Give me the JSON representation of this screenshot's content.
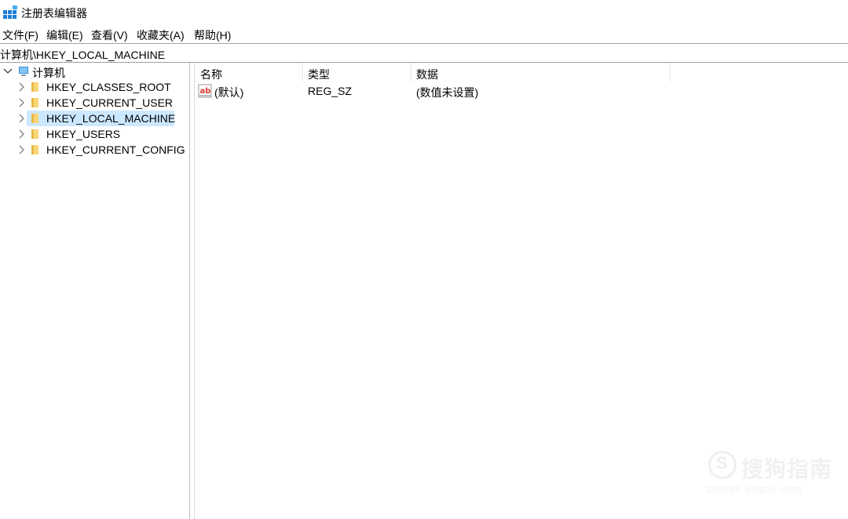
{
  "window": {
    "title": "注册表编辑器"
  },
  "menu": [
    "文件(F)",
    "编辑(E)",
    "查看(V)",
    "收藏夹(A)",
    "帮助(H)"
  ],
  "address": "计算机\\HKEY_LOCAL_MACHINE",
  "tree": {
    "root": "计算机",
    "keys": [
      "HKEY_CLASSES_ROOT",
      "HKEY_CURRENT_USER",
      "HKEY_LOCAL_MACHINE",
      "HKEY_USERS",
      "HKEY_CURRENT_CONFIG"
    ],
    "selected": "HKEY_LOCAL_MACHINE"
  },
  "list": {
    "columns": [
      "名称",
      "类型",
      "数据"
    ],
    "rows": [
      {
        "name": "(默认)",
        "type": "REG_SZ",
        "data": "(数值未设置)"
      }
    ]
  },
  "watermark": {
    "text": "搜狗指南",
    "subtext": "zhinan.sogou.com"
  },
  "colors": {
    "selection": "#cce8ff",
    "folder": "#f8d675",
    "regIconRed": "#d9372b"
  }
}
